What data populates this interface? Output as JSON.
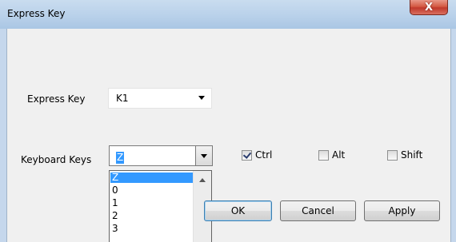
{
  "window": {
    "title": "Express Key",
    "close_glyph": "X"
  },
  "form": {
    "express_key_label": "Express Key",
    "express_key_value": "K1",
    "keyboard_keys_label": "Keyboard Keys",
    "keyboard_keys_value": "Z"
  },
  "dropdown": {
    "options": [
      "Z",
      "0",
      "1",
      "2",
      "3"
    ],
    "selected_index": 0
  },
  "modifiers": {
    "ctrl": {
      "label": "Ctrl",
      "checked": true
    },
    "alt": {
      "label": "Alt",
      "checked": false
    },
    "shift": {
      "label": "Shift",
      "checked": false
    }
  },
  "buttons": {
    "ok": "OK",
    "cancel": "Cancel",
    "apply": "Apply"
  },
  "colors": {
    "selection": "#3399ff",
    "titlebar": "#b9d1ea",
    "close_button": "#c0392b"
  }
}
